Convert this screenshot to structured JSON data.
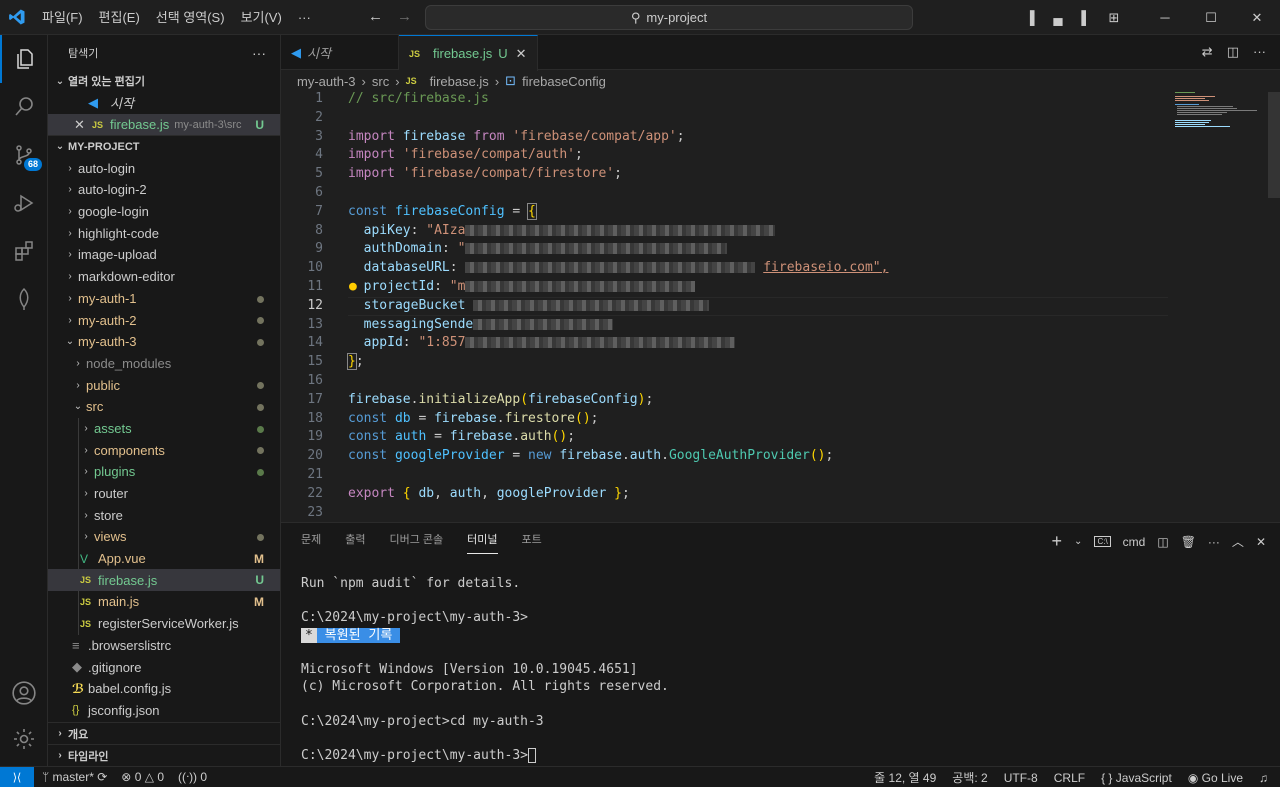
{
  "menu": [
    "파일(F)",
    "편집(E)",
    "선택 영역(S)",
    "보기(V)",
    "···"
  ],
  "search": {
    "text": "my-project"
  },
  "window": {
    "minimize": "─",
    "maximize": "☐",
    "close": "✕"
  },
  "activity": {
    "scm_badge": "68"
  },
  "sidebar": {
    "title": "탐색기",
    "more": "···",
    "open_editors": {
      "label": "열려 있는 편집기",
      "items": [
        {
          "name": "시작"
        },
        {
          "name": "firebase.js",
          "path": "my-auth-3\\src",
          "status": "U"
        }
      ]
    },
    "project": {
      "label": "MY-PROJECT",
      "folders": [
        "auto-login",
        "auto-login-2",
        "google-login",
        "highlight-code",
        "image-upload",
        "markdown-editor",
        "my-auth-1",
        "my-auth-2",
        "my-auth-3"
      ],
      "auth3_children": [
        "node_modules",
        "public",
        "src"
      ],
      "src_children": [
        "assets",
        "components",
        "plugins",
        "router",
        "store",
        "views"
      ],
      "src_files": [
        {
          "name": "App.vue",
          "status": "M"
        },
        {
          "name": "firebase.js",
          "status": "U"
        },
        {
          "name": "main.js",
          "status": "M"
        },
        {
          "name": "registerServiceWorker.js",
          "status": ""
        }
      ],
      "root_files": [
        ".browserslistrc",
        ".gitignore",
        "babel.config.js",
        "jsconfig.json"
      ]
    },
    "outline": "개요",
    "timeline": "타임라인"
  },
  "tabs": [
    {
      "label": "시작"
    },
    {
      "label": "firebase.js",
      "status": "U"
    }
  ],
  "breadcrumb": [
    "my-auth-3",
    "src",
    "firebase.js",
    "firebaseConfig"
  ],
  "code": {
    "line_numbers": [
      "1",
      "2",
      "3",
      "4",
      "5",
      "6",
      "7",
      "8",
      "9",
      "10",
      "11",
      "12",
      "13",
      "14",
      "15",
      "16",
      "17",
      "18",
      "19",
      "20",
      "21",
      "22",
      "23"
    ],
    "current_line": "12",
    "l1": "// src/firebase.js",
    "import_kw": "import",
    "from_kw": "from",
    "firebase_id": "firebase",
    "import1_src": "'firebase/compat/app'",
    "import2_src": "'firebase/compat/auth'",
    "import3_src": "'firebase/compat/firestore'",
    "const_kw": "const",
    "config_id": "firebaseConfig",
    "k_apiKey": "apiKey",
    "v_apiKey_prefix": "\"AIza",
    "k_authDomain": "authDomain",
    "v_authDomain_prefix": "\"",
    "k_databaseURL": "databaseURL",
    "v_databaseURL_suffix": "firebaseio.com\",",
    "k_projectId": "projectId",
    "v_projectId_prefix": "\"m",
    "k_storageBucket": "storageBucket",
    "k_messagingSender": "messagingSende",
    "k_appId": "appId",
    "v_appId_prefix": "\"1:857",
    "init_call": "initializeApp",
    "db_id": "db",
    "firestore_fn": "firestore",
    "auth_id": "auth",
    "auth_fn": "auth",
    "gp_id": "googleProvider",
    "new_kw": "new",
    "gap_cls": "GoogleAuthProvider",
    "export_kw": "export"
  },
  "panel": {
    "tabs": [
      "문제",
      "출력",
      "디버그 콘솔",
      "터미널",
      "포트"
    ],
    "active_tab": "터미널",
    "shell": "cmd",
    "terminal": {
      "l1": "Run `npm audit` for details.",
      "l2": "C:\\2024\\my-project\\my-auth-3>",
      "restored_star": "*",
      "restored_text": " 복원된 기록 ",
      "l4": "Microsoft Windows [Version 10.0.19045.4651]",
      "l5": "(c) Microsoft Corporation. All rights reserved.",
      "l6": "C:\\2024\\my-project>cd my-auth-3",
      "l7": "C:\\2024\\my-project\\my-auth-3>"
    }
  },
  "status": {
    "branch": "master*",
    "errors": "0",
    "warnings": "0",
    "ports": "0",
    "position": "줄 12, 열 49",
    "spaces": "공백: 2",
    "encoding": "UTF-8",
    "eol": "CRLF",
    "language": "JavaScript",
    "golive": "Go Live"
  }
}
